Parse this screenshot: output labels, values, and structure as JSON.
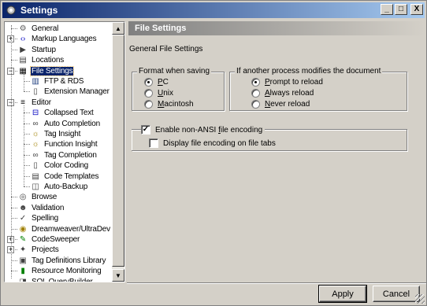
{
  "window": {
    "title": "Settings",
    "controls": {
      "minimize": "_",
      "maximize": "□",
      "close": "X"
    }
  },
  "tree": {
    "items": [
      {
        "label": "General",
        "icon": "gear-icon",
        "indent": 1,
        "selected": false
      },
      {
        "label": "Markup Languages",
        "icon": "code-brackets-icon",
        "indent": 1,
        "expandable": true
      },
      {
        "label": "Startup",
        "icon": "startup-icon",
        "indent": 1
      },
      {
        "label": "Locations",
        "icon": "folder-icon",
        "indent": 1
      },
      {
        "label": "File Settings",
        "icon": "file-settings-icon",
        "indent": 1,
        "selected": true,
        "expanded": true
      },
      {
        "label": "FTP & RDS",
        "icon": "server-icon",
        "indent": 2
      },
      {
        "label": "Extension Manager",
        "icon": "page-icon",
        "indent": 2
      },
      {
        "label": "Editor",
        "icon": "editor-icon",
        "indent": 1,
        "expanded": true
      },
      {
        "label": "Collapsed Text",
        "icon": "collapse-icon",
        "indent": 2
      },
      {
        "label": "Auto Completion",
        "icon": "glasses-icon",
        "indent": 2
      },
      {
        "label": "Tag Insight",
        "icon": "bulb-icon",
        "indent": 2
      },
      {
        "label": "Function Insight",
        "icon": "bulb-icon",
        "indent": 2
      },
      {
        "label": "Tag Completion",
        "icon": "glasses-icon",
        "indent": 2
      },
      {
        "label": "Color Coding",
        "icon": "page-icon",
        "indent": 2
      },
      {
        "label": "Code Templates",
        "icon": "template-icon",
        "indent": 2
      },
      {
        "label": "Auto-Backup",
        "icon": "backup-icon",
        "indent": 2
      },
      {
        "label": "Browse",
        "icon": "browse-icon",
        "indent": 1
      },
      {
        "label": "Validation",
        "icon": "validation-icon",
        "indent": 1
      },
      {
        "label": "Spelling",
        "icon": "spelling-icon",
        "indent": 1
      },
      {
        "label": "Dreamweaver/UltraDev",
        "icon": "dreamweaver-icon",
        "indent": 1
      },
      {
        "label": "CodeSweeper",
        "icon": "broom-icon",
        "indent": 1,
        "expandable": true
      },
      {
        "label": "Projects",
        "icon": "projects-icon",
        "indent": 1,
        "expandable": true
      },
      {
        "label": "Tag Definitions Library",
        "icon": "library-icon",
        "indent": 1
      },
      {
        "label": "Resource Monitoring",
        "icon": "monitor-icon",
        "indent": 1
      },
      {
        "label": "SQL QueryBuilder",
        "icon": "sql-icon",
        "indent": 1
      }
    ]
  },
  "panel": {
    "header": "File Settings",
    "section_title": "General File Settings",
    "format_group": {
      "label": "Format when saving",
      "options": [
        {
          "label_pre": "",
          "label_ul": "P",
          "label_post": "C",
          "checked": true
        },
        {
          "label_pre": "",
          "label_ul": "U",
          "label_post": "nix",
          "checked": false
        },
        {
          "label_pre": "",
          "label_ul": "M",
          "label_post": "acintosh",
          "checked": false
        }
      ]
    },
    "modified_group": {
      "label": "If another process modifies the document",
      "options": [
        {
          "label_pre": "",
          "label_ul": "P",
          "label_post": "rompt to reload",
          "checked": true
        },
        {
          "label_pre": "",
          "label_ul": "A",
          "label_post": "lways reload",
          "checked": false
        },
        {
          "label_pre": "",
          "label_ul": "N",
          "label_post": "ever reload",
          "checked": false
        }
      ]
    },
    "encoding": {
      "enable_label_pre": "Enable non-ANSI ",
      "enable_label_ul": "f",
      "enable_label_post": "ile encoding",
      "enable_checked": true,
      "display_label": "Display file encoding on file tabs",
      "display_checked": false
    }
  },
  "buttons": {
    "apply": "Apply",
    "cancel": "Cancel"
  }
}
